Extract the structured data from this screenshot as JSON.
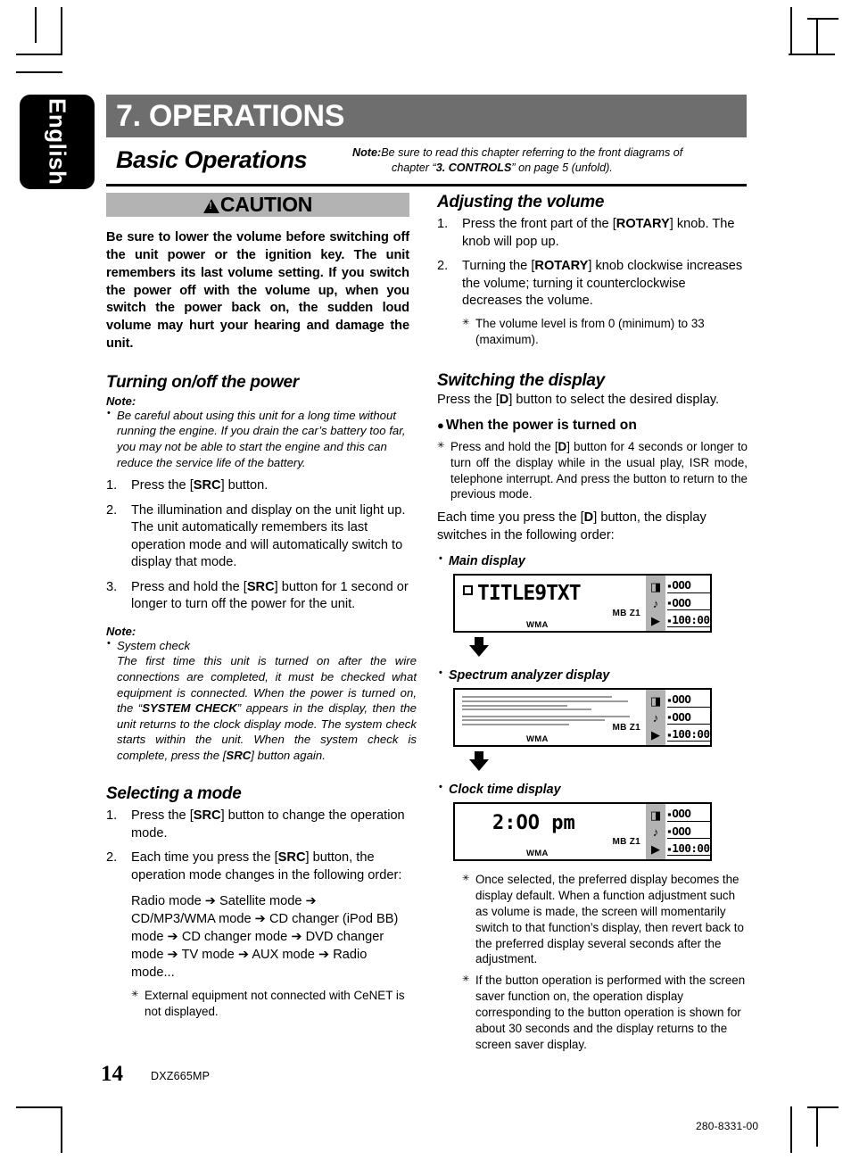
{
  "page": {
    "language_tab": "English",
    "chapter_banner": "7. OPERATIONS",
    "section_title": "Basic Operations",
    "page_number": "14",
    "model": "DXZ665MP",
    "doc_number": "280-8331-00"
  },
  "head_note": {
    "label": "Note:",
    "line1_pre": "Be sure to read this chapter referring to the front diagrams of",
    "line2_pre": "chapter “",
    "line2_bold": "3. CONTROLS",
    "line2_post": "” on page 5 (unfold)."
  },
  "caution": {
    "title": "CAUTION",
    "body": "Be sure to lower the volume before switching off the unit power or the ignition key. The unit remembers its last volume setting. If you switch the power off with the volume up, when you switch the power back on, the sudden loud volume may hurt your hearing and damage the unit."
  },
  "left_column": {
    "turning_power": {
      "heading": "Turning on/off the power",
      "note_label": "Note:",
      "note_bullets": [
        "Be careful about using this unit for a long time without running the engine. If you drain the car’s battery too far, you may not be able to start the engine and this can reduce the service life of the battery."
      ],
      "steps": [
        {
          "n": "1.",
          "pre": "Press the [",
          "b": "SRC",
          "post": "] button."
        },
        {
          "n": "2.",
          "pre": "The illumination and display on the unit light up. The unit automatically remembers its last operation mode and will automatically switch to display that mode.",
          "b": "",
          "post": ""
        },
        {
          "n": "3.",
          "pre": "Press and hold the [",
          "b": "SRC",
          "post": "] button for 1 second or longer to turn off the power for the unit."
        }
      ],
      "note2_label": "Note:",
      "note2_title": "System check",
      "note2_pre": "The first time this unit is turned on after the wire connections are completed, it must be checked what equipment is connected. When the power is turned on, the “",
      "note2_bold": "SYSTEM CHECK",
      "note2_mid": "” appears in the display, then the unit returns to the clock display mode. The system check starts within the unit. When the system check is complete, press the [",
      "note2_bold2": "SRC",
      "note2_post": "] button again."
    },
    "selecting_mode": {
      "heading": "Selecting a mode",
      "steps": [
        {
          "n": "1.",
          "pre": "Press the [",
          "b": "SRC",
          "post": "] button to change the operation mode."
        },
        {
          "n": "2.",
          "pre": "Each time you press the [",
          "b": "SRC",
          "post": "] button, the operation mode changes in the following order:"
        }
      ],
      "mode_chain": "Radio mode ➔ Satellite mode ➔ CD/MP3/WMA mode ➔ CD changer (iPod BB) mode ➔ CD changer mode ➔ DVD changer mode ➔ TV mode ➔ AUX mode ➔ Radio mode...",
      "footnotes": [
        "External equipment not connected with CeNET is not displayed."
      ]
    }
  },
  "right_column": {
    "adjusting_volume": {
      "heading": "Adjusting the volume",
      "steps": [
        {
          "n": "1.",
          "pre": "Press the front part of the [",
          "b": "ROTARY",
          "post": "] knob. The knob will pop up."
        },
        {
          "n": "2.",
          "pre": "Turning the [",
          "b": "ROTARY",
          "post": "] knob clockwise increases the volume; turning it counterclockwise decreases the volume."
        }
      ],
      "footnotes": [
        "The volume level is from 0 (minimum) to 33 (maximum)."
      ]
    },
    "switching_display": {
      "heading": "Switching the display",
      "intro_pre": "Press the [",
      "intro_b": "D",
      "intro_post": "] button to select the desired display.",
      "power_on_heading": "When the power is turned on",
      "power_on_note_pre": "Press and hold the [",
      "power_on_note_b": "D",
      "power_on_note_post": "] button for 4 seconds or longer to turn off the display while in the usual play, ISR mode, telephone interrupt. And press the button to return to the previous mode.",
      "each_time_pre": "Each time you press the [",
      "each_time_b": "D",
      "each_time_post": "] button, the display switches in the following order:",
      "display_labels": {
        "main": "Main display",
        "spectrum": "Spectrum analyzer display",
        "clock": "Clock time display"
      },
      "footnotes": [
        "Once selected, the preferred display becomes the display default. When a function adjustment such as volume is made, the screen will momentarily switch to that function’s display, then revert back to the preferred display several seconds after the adjustment.",
        "If the button operation is performed with the screen saver function on, the operation display corresponding to the button operation is shown for about 30 seconds and the display returns to the screen saver display."
      ]
    },
    "lcd_main": {
      "title_text": "TITLE9TXT",
      "wma": "WMA",
      "mbz1": "MB Z1",
      "rows": [
        "OOO",
        "OOO",
        "100:00"
      ],
      "icons": [
        "album-icon",
        "music-note-icon",
        "play-icon"
      ]
    },
    "lcd_spectrum": {
      "wma": "WMA",
      "mbz1": "MB Z1",
      "rows": [
        "OOO",
        "OOO",
        "100:00"
      ],
      "icons": [
        "album-icon",
        "music-note-icon",
        "play-icon"
      ]
    },
    "lcd_clock": {
      "time_text": "2:OO pm",
      "wma": "WMA",
      "mbz1": "MB Z1",
      "rows": [
        "OOO",
        "OOO",
        "100:00"
      ],
      "icons": [
        "album-icon",
        "music-note-icon",
        "play-icon"
      ]
    }
  }
}
